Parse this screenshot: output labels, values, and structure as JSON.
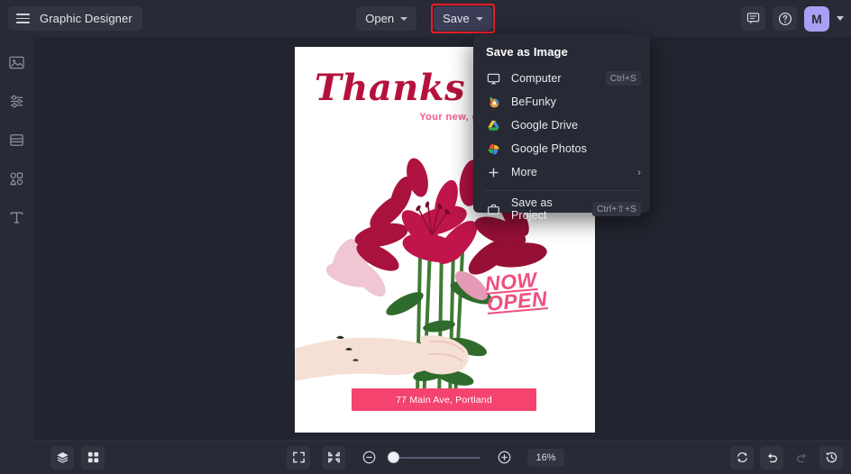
{
  "header": {
    "menu_icon": "hamburger-icon",
    "app_title": "Graphic Designer",
    "open_label": "Open",
    "save_label": "Save",
    "feedback_icon": "feedback-icon",
    "help_icon": "help-icon",
    "avatar_initial": "M",
    "highlight_color": "#ee1c25",
    "save_button_color": "#3a3d55",
    "avatar_color": "#a9a0f5"
  },
  "sidebar": {
    "items": [
      {
        "icon": "image-icon",
        "name": "image"
      },
      {
        "icon": "adjust-sliders-icon",
        "name": "edit"
      },
      {
        "icon": "templates-icon",
        "name": "templates"
      },
      {
        "icon": "graphics-shapes-icon",
        "name": "graphics"
      },
      {
        "icon": "text-icon",
        "name": "text"
      }
    ]
  },
  "dropdown": {
    "heading": "Save as Image",
    "items": [
      {
        "label": "Computer",
        "icon": "monitor-icon",
        "shortcut": "Ctrl+S"
      },
      {
        "label": "BeFunky",
        "icon": "befunky-logo-icon",
        "shortcut": ""
      },
      {
        "label": "Google Drive",
        "icon": "google-drive-icon",
        "shortcut": ""
      },
      {
        "label": "Google Photos",
        "icon": "google-photos-icon",
        "shortcut": ""
      },
      {
        "label": "More",
        "icon": "plus-icon",
        "shortcut": "",
        "arrow": "›"
      }
    ],
    "project": {
      "label": "Save as Project",
      "icon": "briefcase-icon",
      "shortcut": "Ctrl+⇧+S"
    }
  },
  "canvas": {
    "title": "Thanks a",
    "subtitle": "Your new, go-to destination for\nflowers & gifts",
    "badge": "NOW\nOPEN",
    "address": "77 Main Ave, Portland",
    "colors": {
      "title": "#b5123b",
      "subtitle": "#ef5a8a",
      "badge": "#ef4f7f",
      "banner": "#f4436f"
    }
  },
  "bottombar": {
    "layers_icon": "layers-icon",
    "grid_icon": "grid-icon",
    "fit_icon": "fit-to-screen-icon",
    "shrink_icon": "shrink-icon",
    "zoom_out_icon": "zoom-out-icon",
    "zoom_in_icon": "zoom-in-icon",
    "zoom_value": "16%",
    "zoom_slider_position": 0,
    "reset_icon": "reset-icon",
    "undo_icon": "undo-icon",
    "redo_icon": "redo-icon",
    "history_icon": "history-icon"
  }
}
